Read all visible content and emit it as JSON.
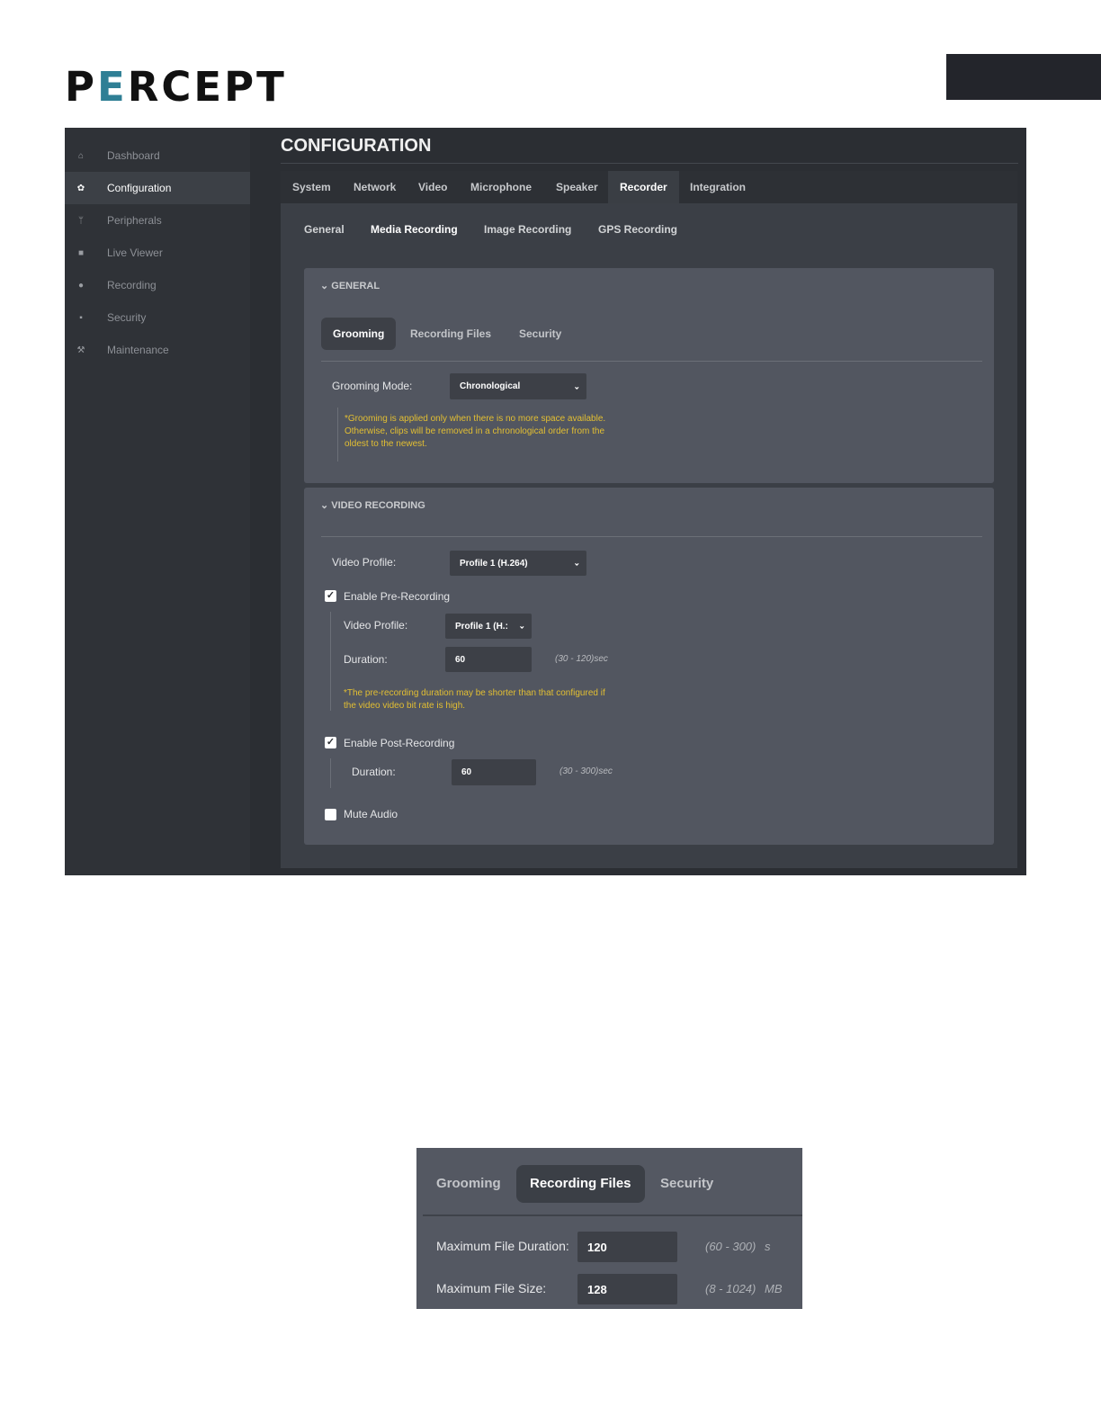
{
  "logo": {
    "part1": "P",
    "accent": "E",
    "part2": "RCEPT"
  },
  "sidebar": {
    "items": [
      {
        "label": "Dashboard",
        "icon": "home-icon",
        "glyph": "⌂"
      },
      {
        "label": "Configuration",
        "icon": "gear-icon",
        "glyph": "✿"
      },
      {
        "label": "Peripherals",
        "icon": "usb-icon",
        "glyph": "ᛘ"
      },
      {
        "label": "Live Viewer",
        "icon": "camera-icon",
        "glyph": "■"
      },
      {
        "label": "Recording",
        "icon": "record-icon",
        "glyph": "●"
      },
      {
        "label": "Security",
        "icon": "lock-icon",
        "glyph": "▪"
      },
      {
        "label": "Maintenance",
        "icon": "wrench-icon",
        "glyph": "⚒"
      }
    ]
  },
  "page_title": "CONFIGURATION",
  "main_tabs": [
    "System",
    "Network",
    "Video",
    "Microphone",
    "Speaker",
    "Recorder",
    "Integration"
  ],
  "sub_tabs": [
    "General",
    "Media Recording",
    "Image Recording",
    "GPS Recording"
  ],
  "general": {
    "title": "GENERAL",
    "tabs": [
      "Grooming",
      "Recording Files",
      "Security"
    ],
    "grooming_mode_label": "Grooming Mode:",
    "grooming_mode_value": "Chronological",
    "note_lines": [
      "*Grooming is applied only when there is no more space available.",
      "Otherwise, clips will be removed in a chronological order from the",
      "oldest to the newest."
    ]
  },
  "video_recording": {
    "title": "VIDEO RECORDING",
    "video_profile_label": "Video Profile:",
    "video_profile_value": "Profile 1 (H.264)",
    "enable_pre_label": "Enable Pre-Recording",
    "enable_pre_checked": true,
    "pre_profile_label": "Video Profile:",
    "pre_profile_value": "Profile 1 (H.:",
    "pre_duration_label": "Duration:",
    "pre_duration_value": "60",
    "pre_duration_range": "(30 - 120)sec",
    "pre_note_lines": [
      "*The pre-recording duration may be shorter than that configured if",
      "the video video bit rate is high."
    ],
    "enable_post_label": "Enable Post-Recording",
    "enable_post_checked": true,
    "post_duration_label": "Duration:",
    "post_duration_value": "60",
    "post_duration_range": "(30 - 300)sec",
    "mute_audio_label": "Mute Audio",
    "mute_audio_checked": false
  },
  "recording_files_panel": {
    "tabs": [
      "Grooming",
      "Recording Files",
      "Security"
    ],
    "max_duration_label": "Maximum File Duration:",
    "max_duration_value": "120",
    "max_duration_range": "(60 - 300)",
    "max_duration_unit": "s",
    "max_size_label": "Maximum File Size:",
    "max_size_value": "128",
    "max_size_range": "(8 - 1024)",
    "max_size_unit": "MB"
  }
}
